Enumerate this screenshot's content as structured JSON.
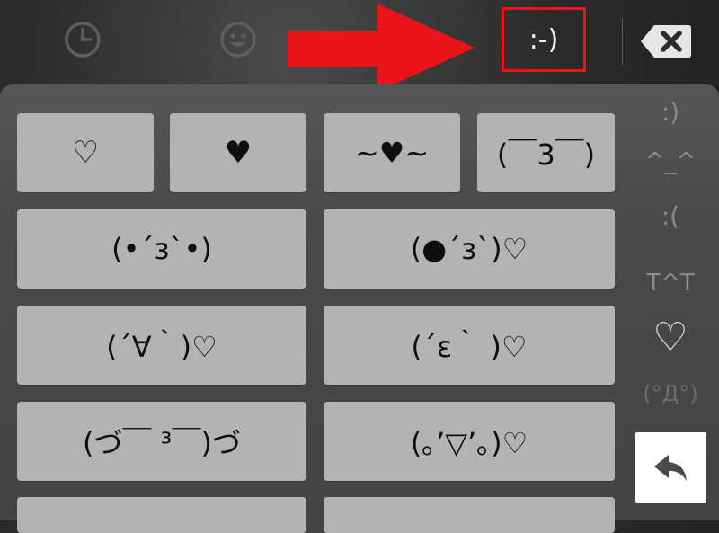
{
  "tabs": {
    "recent_icon": "clock-icon",
    "emoji_icon": "smiley-icon",
    "emoticon_label": ":-)",
    "backspace_icon": "backspace-icon"
  },
  "annotation": {
    "highlight_color": "#e8141a",
    "arrow_color": "#e8141a"
  },
  "emoticons": [
    "♡",
    "♥",
    "~♥~",
    "(￣3￣)",
    "(•´з`•)",
    "(●´з`)♡",
    "(´∀｀)♡",
    "(´ε｀ )♡",
    "(づ￣ ³￣)づ",
    "(｡’▽’｡)♡"
  ],
  "categories": [
    ":)",
    "^_^",
    ":(",
    "T^T",
    "♡",
    "(°Д°)"
  ],
  "return_icon": "return-arrow-icon"
}
